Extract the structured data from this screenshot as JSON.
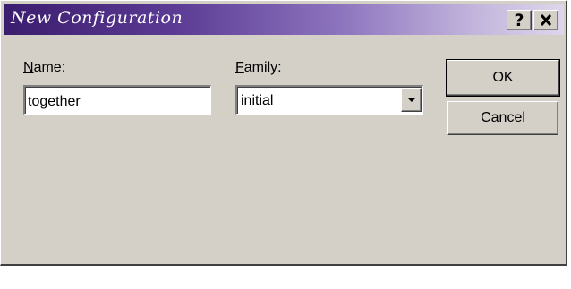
{
  "window": {
    "title": "New Configuration",
    "help_label": "?",
    "close_icon": "close-icon"
  },
  "form": {
    "name_label_mnemonic": "N",
    "name_label_rest": "ame:",
    "name_value": "together",
    "family_label_mnemonic": "F",
    "family_label_rest": "amily:",
    "family_value": "initial",
    "family_dropdown_icon": "chevron-down-icon"
  },
  "buttons": {
    "ok_label": "OK",
    "cancel_label": "Cancel"
  }
}
